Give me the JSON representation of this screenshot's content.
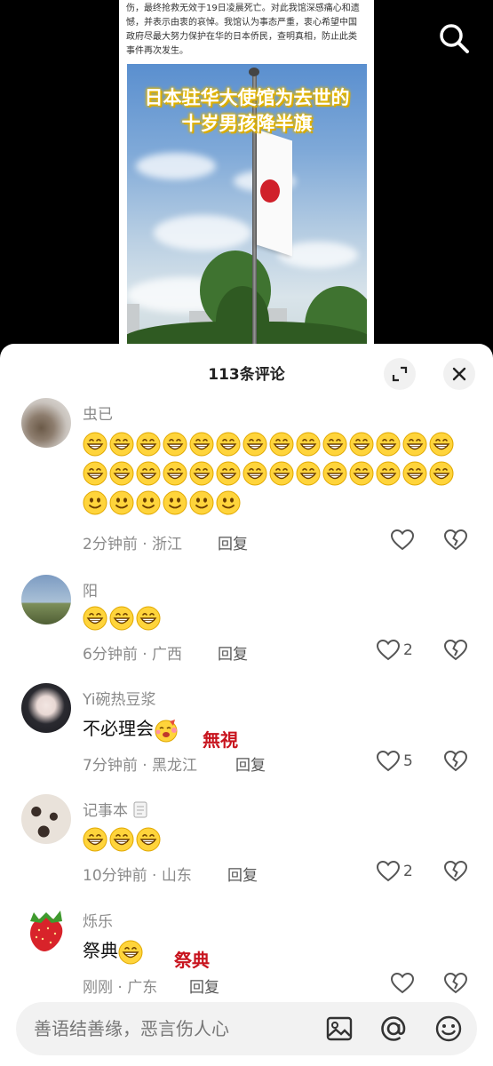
{
  "video": {
    "article_lines": [
      "伤，最终抢救无效于19日凌晨死亡。对此我馆深感痛心和遗",
      "憾，并表示由衷的哀悼。我馆认为事态严重，衷心希望中国",
      "政府尽最大努力保护在华的日本侨民，查明真相，防止此类",
      "事件再次发生。"
    ],
    "headline_line1": "日本驻华大使馆为去世的",
    "headline_line2": "十岁男孩降半旗"
  },
  "comments_panel": {
    "title": "113条评论"
  },
  "comments": [
    {
      "username": "虫已",
      "text": "",
      "grin_count": 28,
      "smile_count": 6,
      "time": "2分钟前",
      "location": "浙江",
      "reply_label": "回复",
      "likes": ""
    },
    {
      "username": "阳",
      "text": "",
      "grin_count": 3,
      "time": "6分钟前",
      "location": "广西",
      "reply_label": "回复",
      "likes": "2"
    },
    {
      "username": "Yi碗热豆浆",
      "text": "不必理会",
      "annotation": "無視",
      "time": "7分钟前",
      "location": "黑龙江",
      "reply_label": "回复",
      "likes": "5"
    },
    {
      "username": "记事本",
      "text": "",
      "grin_count": 3,
      "time": "10分钟前",
      "location": "山东",
      "reply_label": "回复",
      "likes": "2"
    },
    {
      "username": "烁乐",
      "text": "祭典",
      "annotation": "祭典",
      "time": "刚刚",
      "location": "广东",
      "reply_label": "回复",
      "likes": ""
    }
  ],
  "input_bar": {
    "placeholder": "善语结善缘，恶言伤人心"
  },
  "icons": {
    "search": "search-icon",
    "expand": "expand-icon",
    "close": "close-icon",
    "like": "heart-icon",
    "dislike": "broken-heart-icon",
    "image": "image-icon",
    "mention": "at-icon",
    "emoji": "emoji-icon"
  },
  "colors": {
    "annotation_red": "#c8141e",
    "emoji_yellow": "#ffd43b"
  }
}
